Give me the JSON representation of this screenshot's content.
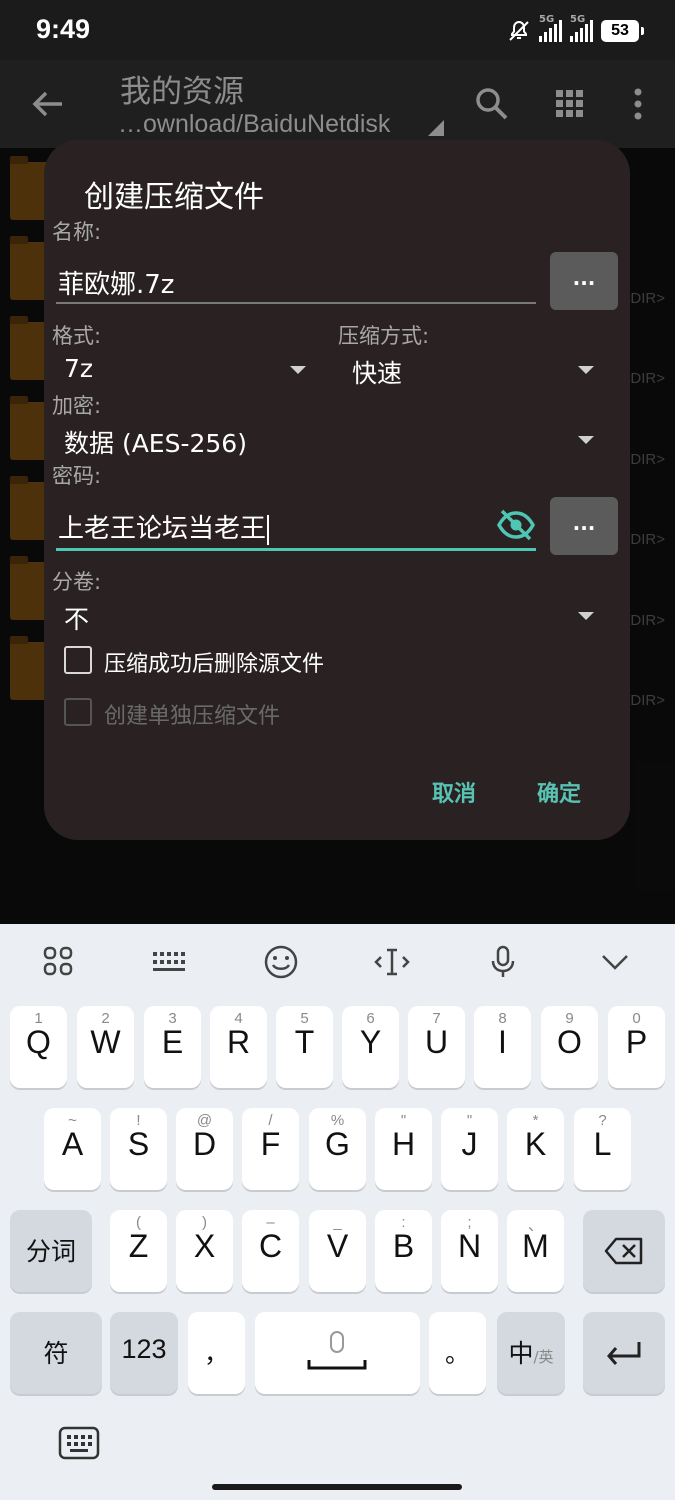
{
  "status_bar": {
    "time": "9:49",
    "signal1": "5G",
    "signal2": "5G",
    "battery": "53"
  },
  "app_bar": {
    "title": "我的资源",
    "subtitle": "…ownload/BaiduNetdisk"
  },
  "file_list": {
    "dir_tag": "DIR>"
  },
  "dialog": {
    "title": "创建压缩文件",
    "name_label": "名称:",
    "name_value": "菲欧娜.7z",
    "name_browse": "...",
    "format_label": "格式:",
    "format_value": "7z",
    "method_label": "压缩方式:",
    "method_value": "快速",
    "encryption_label": "加密:",
    "encryption_value": "数据 (AES-256)",
    "password_label": "密码:",
    "password_value": "上老王论坛当老王",
    "password_browse": "...",
    "split_label": "分卷:",
    "split_value": "不",
    "delete_source_label": "压缩成功后删除源文件",
    "separate_archive_label": "创建单独压缩文件",
    "cancel": "取消",
    "ok": "确定"
  },
  "keyboard": {
    "row1": [
      {
        "main": "Q",
        "sub": "1"
      },
      {
        "main": "W",
        "sub": "2"
      },
      {
        "main": "E",
        "sub": "3"
      },
      {
        "main": "R",
        "sub": "4"
      },
      {
        "main": "T",
        "sub": "5"
      },
      {
        "main": "Y",
        "sub": "6"
      },
      {
        "main": "U",
        "sub": "7"
      },
      {
        "main": "I",
        "sub": "8"
      },
      {
        "main": "O",
        "sub": "9"
      },
      {
        "main": "P",
        "sub": "0"
      }
    ],
    "row2": [
      {
        "main": "A",
        "sub": "~"
      },
      {
        "main": "S",
        "sub": "!"
      },
      {
        "main": "D",
        "sub": "@"
      },
      {
        "main": "F",
        "sub": "/"
      },
      {
        "main": "G",
        "sub": "%"
      },
      {
        "main": "H",
        "sub": "\""
      },
      {
        "main": "J",
        "sub": "\""
      },
      {
        "main": "K",
        "sub": "*"
      },
      {
        "main": "L",
        "sub": "?"
      }
    ],
    "row3": [
      {
        "main": "Z",
        "sub": "("
      },
      {
        "main": "X",
        "sub": ")"
      },
      {
        "main": "C",
        "sub": "–"
      },
      {
        "main": "V",
        "sub": "_"
      },
      {
        "main": "B",
        "sub": ":"
      },
      {
        "main": "N",
        "sub": ";"
      },
      {
        "main": "M",
        "sub": "、"
      }
    ],
    "fenci": "分词",
    "symbols": "符",
    "numbers": "123",
    "comma": "，",
    "period": "。",
    "lang_main": "中",
    "lang_sub": "/英"
  }
}
